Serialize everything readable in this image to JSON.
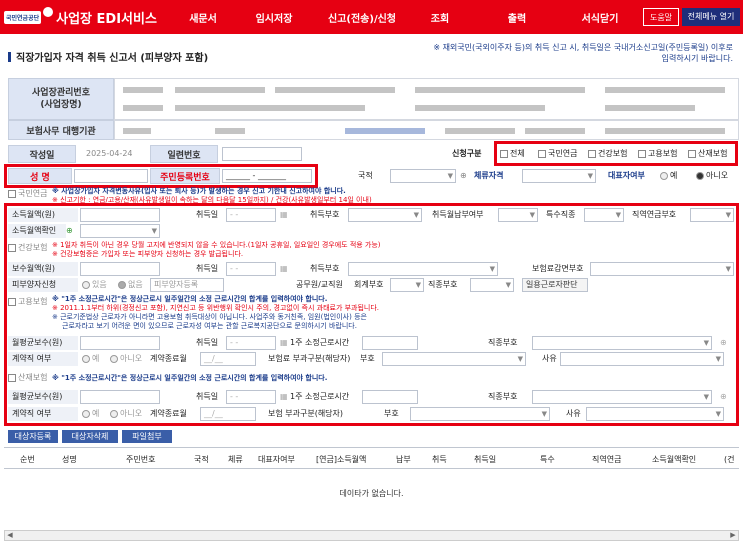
{
  "nav": {
    "org": "국민연금공단",
    "service": "사업장 EDI서비스",
    "items": [
      "새문서",
      "임시저장",
      "신고(전송)/신청",
      "조회",
      "출력",
      "서식닫기"
    ],
    "help": "도움말",
    "all_menu": "전체메뉴 열기"
  },
  "title": "직장가입자 자격 취득 신고서 (피부양자 포함)",
  "notice": "※ 재외국민(국외이주자 등)의 취득 신고 시, 취득일은 국내거소신고일(주민등록일) 이후로 입력하시기 바랍니다.",
  "biz": {
    "no_label": "사업장관리번호\n(사업장명)",
    "agency_label": "보험사무 대행기관"
  },
  "form": {
    "date_label": "작성일",
    "date_value": "2025-04-24",
    "serial_label": "일련번호",
    "apply_label": "신청구분",
    "apply_opts": [
      "전체",
      "국민연금",
      "건강보험",
      "고용보험",
      "산재보험"
    ],
    "name_label": "성  명",
    "rrn_label": "주민등록번호",
    "rrn_value": "______ - _______",
    "nation_label": "국적",
    "stay_label": "체류자격",
    "rep_label": "대표자여부",
    "rep_opts": [
      "예",
      "아니오"
    ]
  },
  "pension": {
    "title": "국민연금",
    "warn1": "※ 사업장가입자 자격변동사유(입사 또는 퇴사 등)가 발생하는 경우 신고 기한내 신고하여야 합니다.",
    "warn2": "※ 신고기한 : 연금/고용/산재(사유발생일이 속하는 달의 다음달 15일까지) / 건강(사유발생일부터 14일 이내)",
    "income_label": "소득월액(원)",
    "acq_label": "취득일",
    "acq_code_label": "취득부호",
    "acq_month_label": "취득월납부여부",
    "special_label": "특수직종",
    "job_label": "직역연금부호",
    "confirm_label": "소득월액확인",
    "date_ph": "- -"
  },
  "health": {
    "title": "건강보험",
    "warn1": "※ 1일자 취득이 아닌 경우 당월 고지에 반영되지 않을 수 있습니다.(1일자 공휴일, 일요일인 경우에도 적용 가능)",
    "warn2": "※ 건강보험증은 가입자 또는 피부양자 신청하는 경우 발급됩니다.",
    "pay_label": "보수월액(원)",
    "acq_label": "취득일",
    "acq_code_label": "취득부호",
    "reduce_label": "보험료감면부호",
    "dep_label": "피부양자신청",
    "dep_opts": [
      "있음",
      "없음"
    ],
    "dep_btn": "피부양자등록",
    "civil_label": "공무원/교직원",
    "acct_label": "회계부호",
    "jobcode_label": "직종부호",
    "daily_btn": "일용근로자판단",
    "date_ph": "- -"
  },
  "employment": {
    "title": "고용보험",
    "warn1": "※ \"1주 소정근로시간\"은 정상근로시 일주일간의 소정 근로시간의 합계를 입력하여야 합니다.",
    "warn2": "※ 2011.1.1부터 하위(경정신고 포함), 지연신고 등 위반행위 확인시 주의, 경고없이 즉시 과태료가 부과됩니다.",
    "warn3": "※ 근로기준법상 근로자가 아니라면 고용보험 취득대상이 아닙니다. 사업주와 동거친족, 임원(법인이사) 등은",
    "warn4": "근로자라고 보기 어려운 면이 있으므로 근로자성 여부는 관할 근로복지공단으로 문의하시기 바랍니다.",
    "pay_label": "월평균보수(원)",
    "acq_label": "취득일",
    "hours_label": "1주 소정근로시간",
    "jobcode_label": "직종부호",
    "contract_label": "계약직 여부",
    "contract_opts": [
      "예",
      "아니오"
    ],
    "end_label": "계약종료월",
    "charge_label": "보험료 부과구분(해당자)",
    "code_label": "부호",
    "reason_label": "사유",
    "date_ph": "- -",
    "month_ph": "__/__"
  },
  "industrial": {
    "title": "산재보험",
    "warn1": "※ \"1주 소정근로시간\"은 정상근로시 일주일간의 소정 근로시간의 합계를 입력하여야 합니다.",
    "pay_label": "월평균보수(원)",
    "acq_label": "취득일",
    "hours_label": "1주 소정근로시간",
    "jobcode_label": "직종부호",
    "contract_label": "계약직 여부",
    "contract_opts": [
      "예",
      "아니오"
    ],
    "end_label": "계약종료월",
    "charge_label": "보험 부과구분(해당자)",
    "code_label": "부호",
    "reason_label": "사유",
    "date_ph": "- -",
    "month_ph": "__/__"
  },
  "actions": [
    "대상자등록",
    "대상자삭제",
    "파일첨부"
  ],
  "table": {
    "columns": [
      "순번",
      "성명",
      "주민번호",
      "국적",
      "체류",
      "대표자여부",
      "[연금]소득월액",
      "납부",
      "취득",
      "취득일",
      "특수",
      "직역연금",
      "소득월액확인",
      "(건"
    ],
    "empty": "데이타가 없습니다."
  }
}
